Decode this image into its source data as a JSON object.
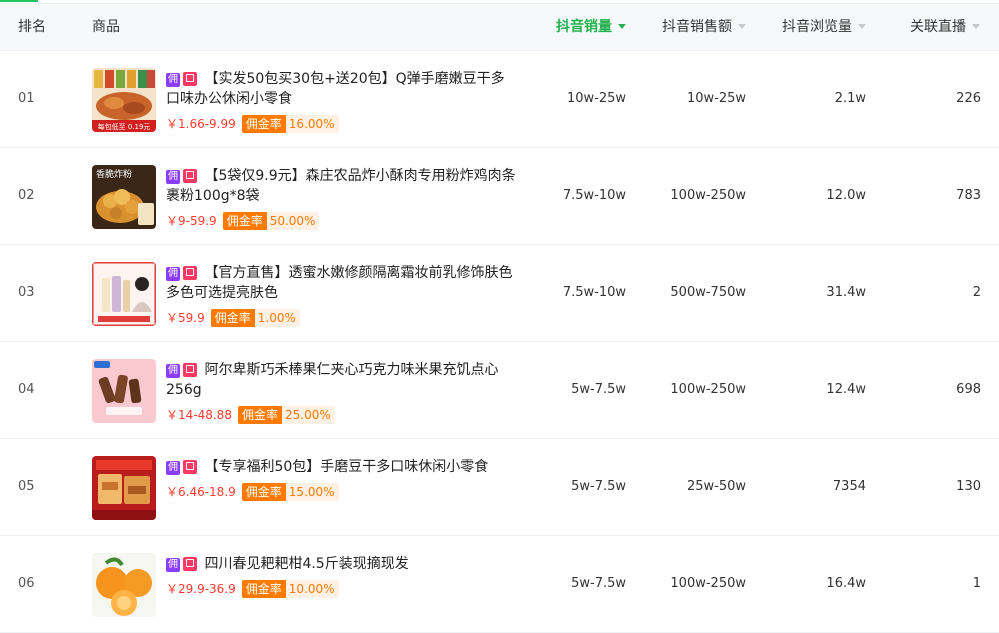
{
  "header": {
    "rank": "排名",
    "product": "商品",
    "volume": "抖音销量",
    "sales": "抖音销售额",
    "views": "抖音浏览量",
    "live": "关联直播"
  },
  "colors": {
    "accent_green": "#22b14c",
    "price_red": "#ff3b30",
    "commission_orange": "#ff7a00",
    "badge_purple": "#8b3dff",
    "badge_pink": "#ff3864"
  },
  "rows": [
    {
      "rank": "01",
      "badge_yong": "佣",
      "title": "【实发50包买30包+送20包】Q弹手磨嫩豆干多口味办公休闲小零食",
      "price": "￥1.66-9.99",
      "rate_label": "佣金率",
      "rate": "16.00%",
      "thumb_text": "每包低至 0.19元",
      "volume": "10w-25w",
      "sales": "10w-25w",
      "views": "2.1w",
      "live": "226"
    },
    {
      "rank": "02",
      "badge_yong": "佣",
      "title": "【5袋仅9.9元】森庄农品炸小酥肉专用粉炸鸡肉条裹粉100g*8袋",
      "price": "￥9-59.9",
      "rate_label": "佣金率",
      "rate": "50.00%",
      "thumb_text": "香脆炸粉",
      "volume": "7.5w-10w",
      "sales": "100w-250w",
      "views": "12.0w",
      "live": "783"
    },
    {
      "rank": "03",
      "badge_yong": "佣",
      "title": "【官方直售】透蜜水嫩修颜隔离霜妆前乳修饰肤色多色可选提亮肤色",
      "price": "￥59.9",
      "rate_label": "佣金率",
      "rate": "1.00%",
      "thumb_text": "",
      "volume": "7.5w-10w",
      "sales": "500w-750w",
      "views": "31.4w",
      "live": "2"
    },
    {
      "rank": "04",
      "badge_yong": "佣",
      "title": "阿尔卑斯巧禾棒果仁夹心巧克力味米果充饥点心256g",
      "price": "￥14-48.88",
      "rate_label": "佣金率",
      "rate": "25.00%",
      "thumb_text": "",
      "volume": "5w-7.5w",
      "sales": "100w-250w",
      "views": "12.4w",
      "live": "698"
    },
    {
      "rank": "05",
      "badge_yong": "佣",
      "title": "【专享福利50包】手磨豆干多口味休闲小零食",
      "price": "￥6.46-18.9",
      "rate_label": "佣金率",
      "rate": "15.00%",
      "thumb_text": "",
      "volume": "5w-7.5w",
      "sales": "25w-50w",
      "views": "7354",
      "live": "130"
    },
    {
      "rank": "06",
      "badge_yong": "佣",
      "title": "四川春见耙耙柑4.5斤装现摘现发",
      "price": "￥29.9-36.9",
      "rate_label": "佣金率",
      "rate": "10.00%",
      "thumb_text": "",
      "volume": "5w-7.5w",
      "sales": "100w-250w",
      "views": "16.4w",
      "live": "1"
    }
  ]
}
